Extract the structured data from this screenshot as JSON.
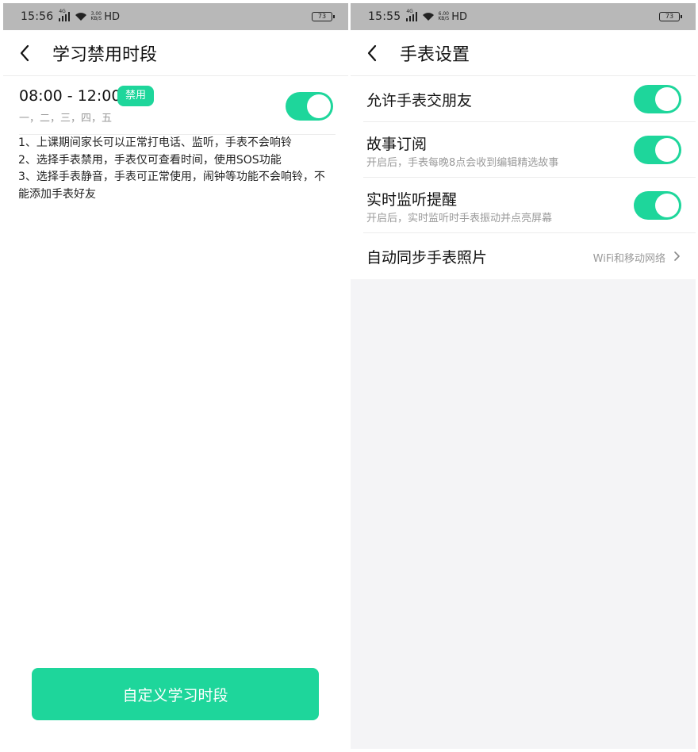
{
  "colors": {
    "accent": "#1ed69b",
    "statusbar": "#b8b8b8"
  },
  "left": {
    "status": {
      "time": "15:56",
      "net": "4G",
      "speed_top": "3.00",
      "speed_bottom": "KB/S",
      "hd": "HD",
      "battery": "73"
    },
    "header": {
      "back_icon": "chevron-left-icon",
      "title": "学习禁用时段"
    },
    "period": {
      "time_range": "08:00 - 12:00",
      "tag": "禁用",
      "days": "一，二，三，四，五",
      "enabled": true
    },
    "notes": [
      "1、上课期间家长可以正常打电话、监听，手表不会响铃",
      "2、选择手表禁用，手表仅可查看时间，使用SOS功能",
      "3、选择手表静音，手表可正常使用，闹钟等功能不会响铃，不能添加手表好友"
    ],
    "cta_label": "自定义学习时段"
  },
  "right": {
    "status": {
      "time": "15:55",
      "net": "4G",
      "speed_top": "6.00",
      "speed_bottom": "KB/S",
      "hd": "HD",
      "battery": "73"
    },
    "header": {
      "back_icon": "chevron-left-icon",
      "title": "手表设置"
    },
    "settings": [
      {
        "label": "允许手表交朋友",
        "sub": "",
        "enabled": true
      },
      {
        "label": "故事订阅",
        "sub": "开启后，手表每晚8点会收到编辑精选故事",
        "enabled": true
      },
      {
        "label": "实时监听提醒",
        "sub": "开启后，实时监听时手表振动并点亮屏幕",
        "enabled": true
      },
      {
        "label": "自动同步手表照片",
        "value": "WiFi和移动网络",
        "icon": "chevron-right-icon"
      }
    ]
  }
}
